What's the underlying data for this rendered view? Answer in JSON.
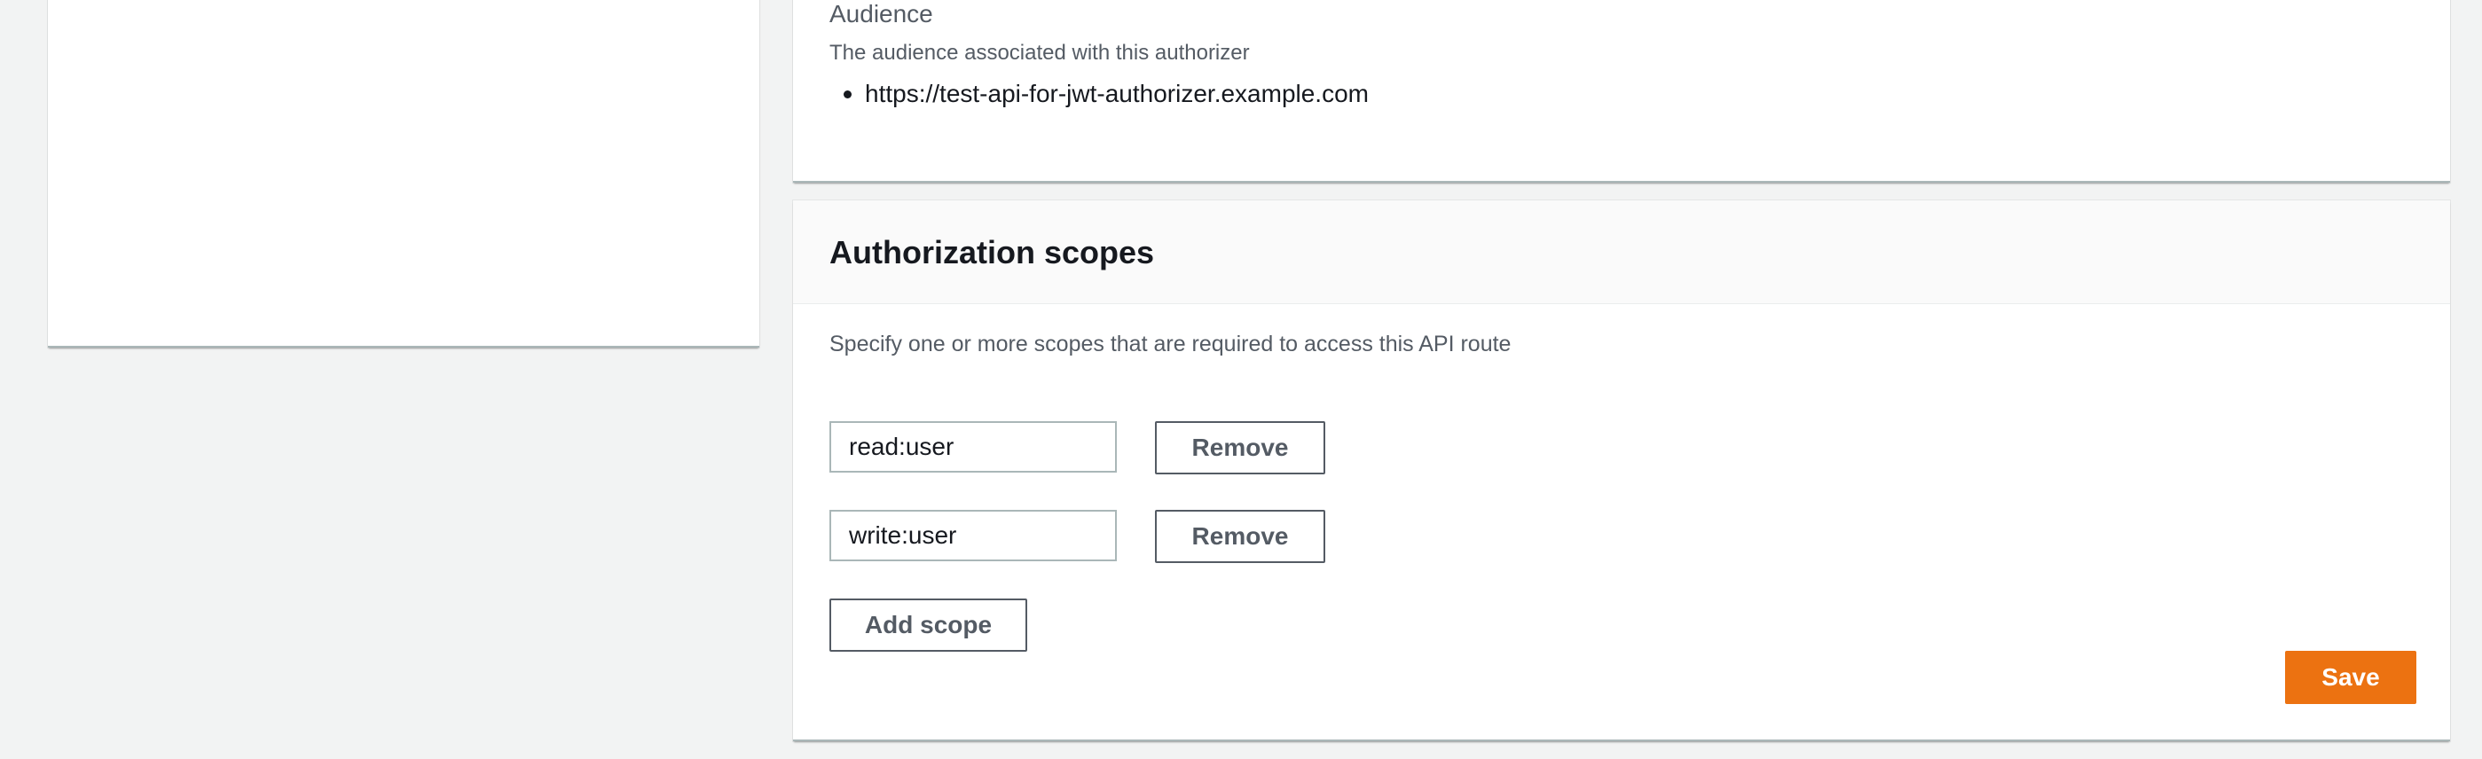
{
  "audience": {
    "label": "Audience",
    "description": "The audience associated with this authorizer",
    "items": [
      "https://test-api-for-jwt-authorizer.example.com"
    ]
  },
  "scopes": {
    "title": "Authorization scopes",
    "description": "Specify one or more scopes that are required to access this API route",
    "entries": [
      {
        "value": "read:user",
        "remove_label": "Remove"
      },
      {
        "value": "write:user",
        "remove_label": "Remove"
      }
    ],
    "add_label": "Add scope",
    "save_label": "Save"
  },
  "colors": {
    "page_background": "#f2f3f3",
    "panel_background": "#ffffff",
    "primary_button": "#ec7211",
    "secondary_text": "#545b64",
    "text": "#16191f"
  }
}
